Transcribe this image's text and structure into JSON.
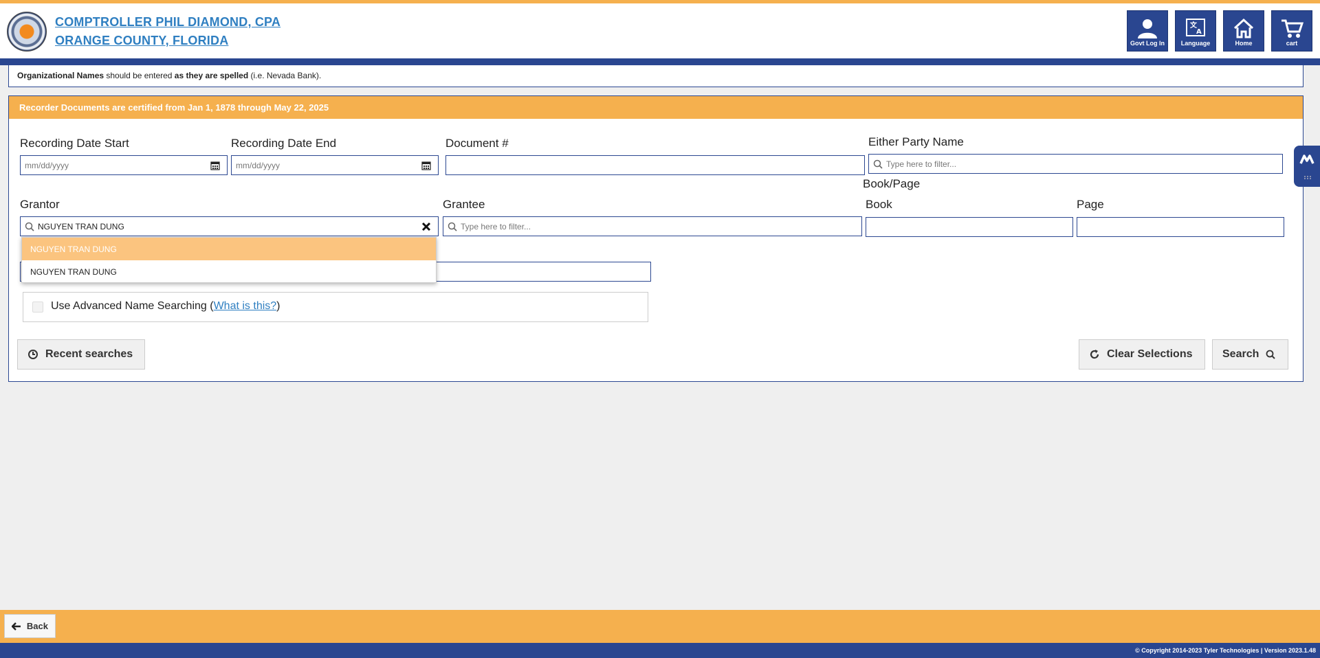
{
  "header": {
    "title_line1": "COMPTROLLER PHIL DIAMOND, CPA",
    "title_line2": "ORANGE COUNTY, FLORIDA",
    "buttons": {
      "govt_login": "Govt Log In",
      "language": "Language",
      "home": "Home",
      "cart": "cart"
    }
  },
  "info": {
    "part1": "Organizational Names",
    "part2": " should be entered ",
    "part3": "as they are spelled",
    "part4": " (i.e. Nevada Bank)."
  },
  "panel": {
    "heading": "Recorder Documents are certified from Jan 1, 1878 through May 22, 2025"
  },
  "form": {
    "recording_date_start": {
      "label": "Recording Date Start",
      "placeholder": "mm/dd/yyyy"
    },
    "recording_date_end": {
      "label": "Recording Date End",
      "placeholder": "mm/dd/yyyy"
    },
    "document_number": {
      "label": "Document #",
      "value": ""
    },
    "either_party": {
      "label": "Either Party Name",
      "placeholder": "Type here to filter..."
    },
    "book_page_group": "Book/Page",
    "book": {
      "label": "Book",
      "value": ""
    },
    "page": {
      "label": "Page",
      "value": ""
    },
    "grantor": {
      "label": "Grantor",
      "value": "NGUYEN TRAN DUNG"
    },
    "grantee": {
      "label": "Grantee",
      "placeholder": "Type here to filter..."
    },
    "dropdown_options": [
      "NGUYEN TRAN DUNG",
      "NGUYEN TRAN DUNG"
    ],
    "advanced": {
      "label": "Use Advanced Name Searching (",
      "link": "What is this?",
      "close": ")"
    }
  },
  "buttons": {
    "recent": "Recent searches",
    "clear": "Clear Selections",
    "search": "Search"
  },
  "footer": {
    "back": "Back",
    "copyright": "© Copyright 2014-2023 Tyler Technologies | Version 2023.1.48"
  },
  "colors": {
    "accent_orange": "#f5b04e",
    "brand_blue": "#2a4690",
    "link_blue": "#2f7fc1"
  }
}
